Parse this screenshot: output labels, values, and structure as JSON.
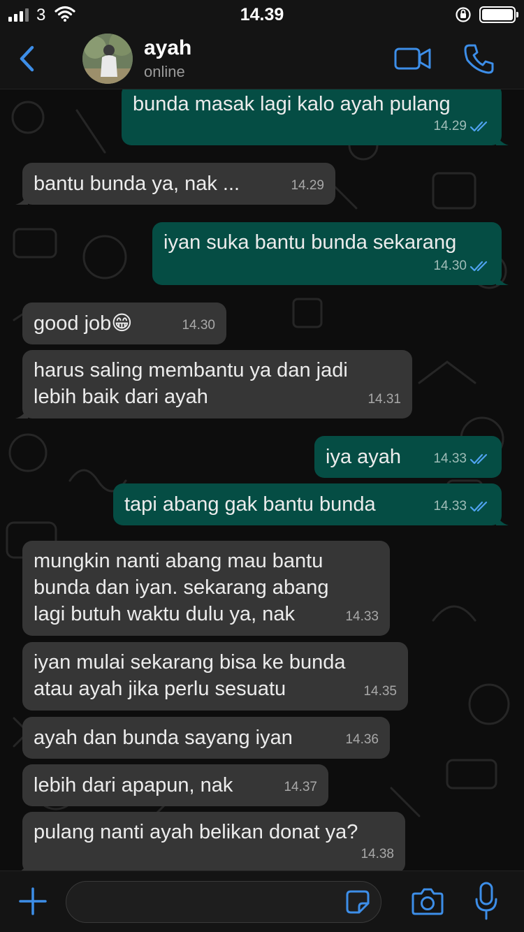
{
  "status_bar": {
    "carrier": "3",
    "time": "14.39"
  },
  "header": {
    "contact_name": "ayah",
    "contact_status": "online"
  },
  "messages": [
    {
      "dir": "out",
      "text": "bunda masak lagi kalo ayah pulang",
      "time": "14.29",
      "ticks": "read"
    },
    {
      "dir": "in",
      "text": "bantu bunda ya, nak ...",
      "time": "14.29"
    },
    {
      "dir": "out",
      "text": "iyan suka bantu bunda sekarang",
      "time": "14.30",
      "ticks": "read"
    },
    {
      "dir": "in",
      "text": "good job😁",
      "time": "14.30"
    },
    {
      "dir": "in",
      "text": "harus saling membantu ya dan jadi\nlebih baik dari ayah",
      "time": "14.31"
    },
    {
      "dir": "out",
      "text": "iya ayah",
      "time": "14.33",
      "ticks": "read"
    },
    {
      "dir": "out",
      "text": "tapi abang gak bantu bunda",
      "time": "14.33",
      "ticks": "read"
    },
    {
      "dir": "in",
      "text": "mungkin nanti abang mau bantu\nbunda dan iyan. sekarang abang\nlagi butuh waktu dulu ya, nak",
      "time": "14.33"
    },
    {
      "dir": "in",
      "text": "iyan mulai sekarang bisa ke bunda\natau ayah jika perlu sesuatu",
      "time": "14.35"
    },
    {
      "dir": "in",
      "text": "ayah dan bunda sayang iyan",
      "time": "14.36"
    },
    {
      "dir": "in",
      "text": "lebih dari apapun, nak",
      "time": "14.37"
    },
    {
      "dir": "in",
      "text": "pulang nanti ayah belikan donat ya?",
      "time": "14.38"
    }
  ],
  "input": {
    "value": "",
    "placeholder": ""
  },
  "icons": {
    "back": "chevron-left-icon",
    "video": "video-camera-icon",
    "call": "phone-icon",
    "plus": "plus-icon",
    "sticker": "sticker-icon",
    "camera": "camera-icon",
    "mic": "microphone-icon"
  },
  "colors": {
    "accent": "#3d8ee8",
    "outgoing_bubble": "#054d44",
    "incoming_bubble": "#363636",
    "read_ticks": "#4fa3f0"
  }
}
